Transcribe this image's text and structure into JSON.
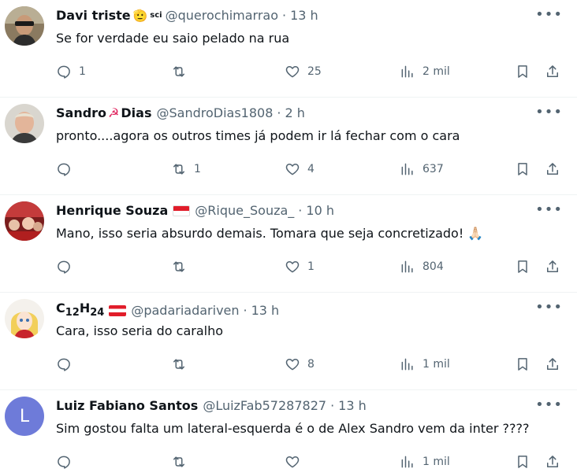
{
  "tweets": [
    {
      "name": "Davi triste",
      "name_suffix": "🫡",
      "badge": "sci",
      "handle": "@querochimarrao",
      "time": "13 h",
      "text": "Se for verdade eu saio pelado na rua",
      "replies": "1",
      "retweets": "",
      "likes": "25",
      "views": "2 mil"
    },
    {
      "name": "Sandro",
      "name_suffix": "☭",
      "name_end": " Dias",
      "handle": "@SandroDias1808",
      "time": "2 h",
      "text": "pronto....agora os outros times já podem ir lá fechar com o cara",
      "replies": "",
      "retweets": "1",
      "likes": "4",
      "views": "637"
    },
    {
      "name": "Henrique Souza",
      "handle": "@Rique_Souza_",
      "time": "10 h",
      "text": "Mano, isso seria absurdo demais. Tomara que seja concretizado! 🙏🏻",
      "replies": "",
      "retweets": "",
      "likes": "1",
      "views": "804"
    },
    {
      "name_main": "C",
      "name_sub1": "12",
      "name_mid": "H",
      "name_sub2": "24",
      "handle": "@padariadariven",
      "time": "13 h",
      "text": "Cara, isso seria do caralho",
      "replies": "",
      "retweets": "",
      "likes": "8",
      "views": "1 mil"
    },
    {
      "name": "Luiz Fabiano Santos",
      "avatar_letter": "L",
      "handle": "@LuizFab57287827",
      "time": "13 h",
      "text": "Sim gostou falta um lateral-esquerda é o de Alex Sandro vem da inter ????",
      "replies": "",
      "retweets": "",
      "likes": "",
      "views": "1 mil"
    }
  ],
  "ui": {
    "dot": "·",
    "more": "•••"
  },
  "colors": {
    "text": "#0f1419",
    "secondary": "#536471",
    "divider": "#eff3f4",
    "avatar_l": "#6e7bd9"
  },
  "icons": [
    "reply-icon",
    "retweet-icon",
    "like-icon",
    "views-icon",
    "bookmark-icon",
    "share-icon",
    "more-icon"
  ]
}
